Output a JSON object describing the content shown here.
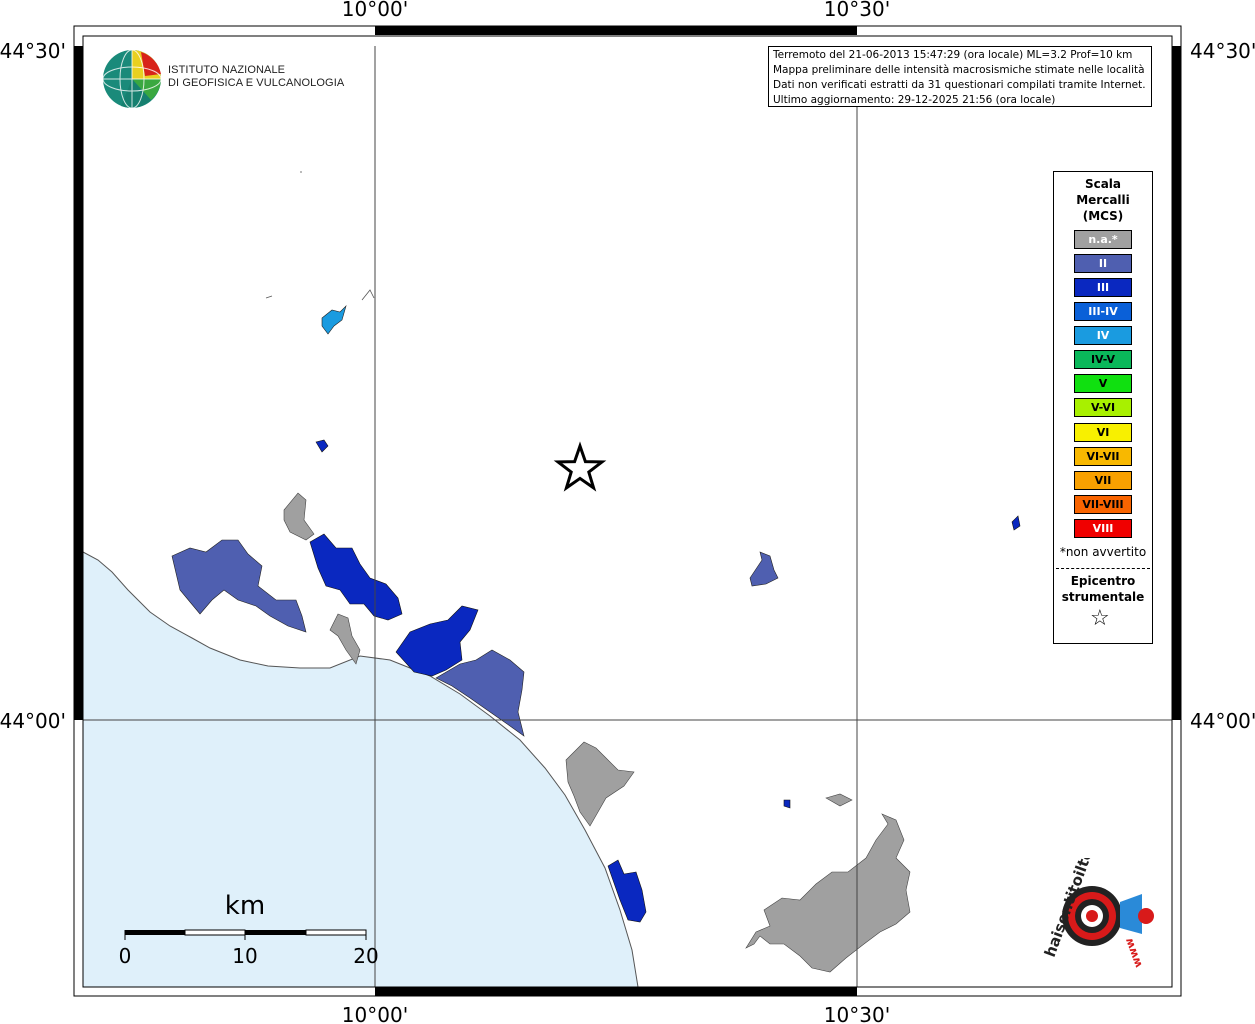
{
  "map": {
    "lat_top": "44°30'",
    "lat_mid": "44°00'",
    "lon_left": "10°00'",
    "lon_right": "10°30'"
  },
  "info": {
    "line1": "Terremoto del 21-06-2013 15:47:29 (ora locale) ML=3.2 Prof=10 km",
    "line2": "Mappa preliminare delle intensità macrosismiche stimate nelle località",
    "line3": "Dati non verificati estratti da 31 questionari compilati tramite Internet.",
    "line4": "Ultimo aggiornamento: 29-12-2025 21:56 (ora locale)"
  },
  "logo": {
    "line1": "ISTITUTO NAZIONALE",
    "line2": "DI GEOFISICA E VULCANOLOGIA"
  },
  "legend": {
    "title_line1": "Scala",
    "title_line2": "Mercalli",
    "title_line3": "(MCS)",
    "items": [
      {
        "label": "n.a.*",
        "color": "#a0a0a0"
      },
      {
        "label": "II",
        "color": "#4f5fb0"
      },
      {
        "label": "III",
        "color": "#0a28c0"
      },
      {
        "label": "III-IV",
        "color": "#0a60d8"
      },
      {
        "label": "IV",
        "color": "#1a9be0"
      },
      {
        "label": "IV-V",
        "color": "#0ab85a"
      },
      {
        "label": "V",
        "color": "#10e010"
      },
      {
        "label": "V-VI",
        "color": "#a8f000"
      },
      {
        "label": "VI",
        "color": "#f8f000"
      },
      {
        "label": "VI-VII",
        "color": "#f8b800"
      },
      {
        "label": "VII",
        "color": "#f8a000"
      },
      {
        "label": "VII-VIII",
        "color": "#f86400"
      },
      {
        "label": "VIII",
        "color": "#f00000"
      }
    ],
    "note": "*non avvertito",
    "epicenter_line1": "Epicentro",
    "epicenter_line2": "strumentale"
  },
  "scale": {
    "unit": "km",
    "label_0": "0",
    "label_10": "10",
    "label_20": "20"
  },
  "hsit": {
    "text": "haisentitoilterremoto.it",
    "url_text": "www"
  },
  "colors": {
    "sea": "#dff0fa",
    "na": "#a0a0a0",
    "ii": "#4f5fb0",
    "iii": "#0a28c0",
    "iv": "#1a9be0"
  }
}
